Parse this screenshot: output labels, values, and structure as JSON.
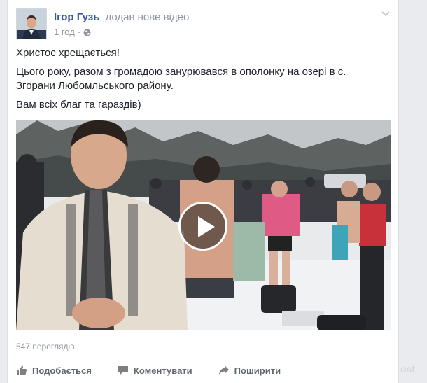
{
  "post": {
    "author": "Ігор Гузь",
    "action": "додав нове відео",
    "time": "1 год",
    "privacy_icon": "globe-icon",
    "options_icon": "chevron-down-icon",
    "paragraphs": [
      "Христос хрещається!",
      "Цього року, разом з громадою занурювався в ополонку на озері в с. Згорани Любомльського району.",
      "Вам всіх благ та гараздів)"
    ],
    "video": {
      "play_icon": "play-icon"
    },
    "views": "547 переглядів"
  },
  "actions": {
    "like": "Подобається",
    "comment": "Коментувати",
    "share": "Поширити"
  },
  "watermark": "ost",
  "colors": {
    "link": "#365899",
    "meta": "#90949c",
    "text": "#1d2129",
    "background": "#e9ebee",
    "action": "#616770"
  }
}
